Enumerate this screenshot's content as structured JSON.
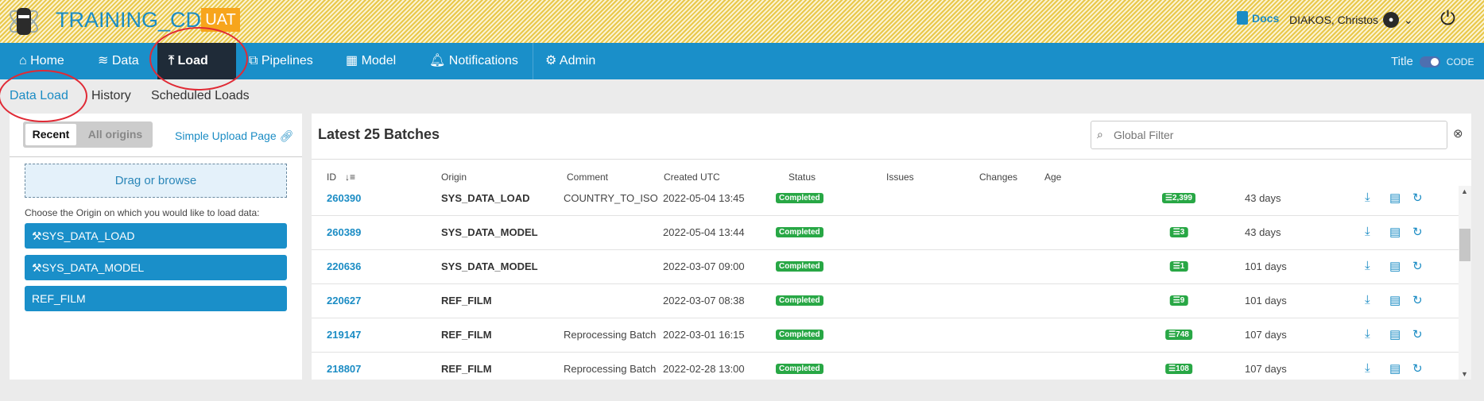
{
  "header": {
    "app_title": "TRAINING_CD",
    "env_badge": "UAT",
    "docs_label": "Docs",
    "user_name": "DIAKOS, Christos"
  },
  "nav": {
    "items": [
      {
        "label": "Home",
        "icon": "home-icon"
      },
      {
        "label": "Data",
        "icon": "database-icon"
      },
      {
        "label": "Load",
        "icon": "upload-icon",
        "active": true
      },
      {
        "label": "Pipelines",
        "icon": "pipelines-icon"
      },
      {
        "label": "Model",
        "icon": "model-icon"
      },
      {
        "label": "Notifications",
        "icon": "bell-icon"
      },
      {
        "label": "Admin",
        "icon": "gear-icon"
      }
    ],
    "toggle": {
      "left_label": "Title",
      "right_label": "CODE",
      "state": "CODE"
    }
  },
  "subnav": {
    "items": [
      "Data Load",
      "History",
      "Scheduled Loads"
    ],
    "active": "Data Load"
  },
  "left_panel": {
    "segments": [
      "Recent",
      "All origins"
    ],
    "selected_segment": "Recent",
    "simple_upload_link": "Simple Upload Page",
    "dropzone": "Drag or browse",
    "choose_text": "Choose the Origin on which you would like to load data:",
    "origins": [
      "SYS_DATA_LOAD",
      "SYS_DATA_MODEL",
      "REF_FILM"
    ]
  },
  "batches": {
    "title": "Latest 25 Batches",
    "filter_placeholder": "Global Filter",
    "columns": [
      "ID",
      "Origin",
      "Comment",
      "Created UTC",
      "Status",
      "Issues",
      "Changes",
      "Age"
    ],
    "rows": [
      {
        "id": "260390",
        "origin": "SYS_DATA_LOAD",
        "comment": "COUNTRY_TO_ISO",
        "created": "2022-05-04 13:45",
        "status": "Completed",
        "issues": "",
        "changes": "2,399",
        "age": "43 days"
      },
      {
        "id": "260389",
        "origin": "SYS_DATA_MODEL",
        "comment": "",
        "created": "2022-05-04 13:44",
        "status": "Completed",
        "issues": "",
        "changes": "3",
        "age": "43 days"
      },
      {
        "id": "220636",
        "origin": "SYS_DATA_MODEL",
        "comment": "",
        "created": "2022-03-07 09:00",
        "status": "Completed",
        "issues": "",
        "changes": "1",
        "age": "101 days"
      },
      {
        "id": "220627",
        "origin": "REF_FILM",
        "comment": "",
        "created": "2022-03-07 08:38",
        "status": "Completed",
        "issues": "",
        "changes": "9",
        "age": "101 days"
      },
      {
        "id": "219147",
        "origin": "REF_FILM",
        "comment": "Reprocessing Batch",
        "created": "2022-03-01 16:15",
        "status": "Completed",
        "issues": "",
        "changes": "748",
        "age": "107 days"
      },
      {
        "id": "218807",
        "origin": "REF_FILM",
        "comment": "Reprocessing Batch",
        "created": "2022-02-28 13:00",
        "status": "Completed",
        "issues": "",
        "changes": "108",
        "age": "107 days"
      }
    ]
  },
  "colors": {
    "nav": "#1a8fc9",
    "active_nav": "#1f2b38",
    "accent": "#1b8cc4",
    "success": "#28a745",
    "env_badge": "#f7a51c"
  }
}
